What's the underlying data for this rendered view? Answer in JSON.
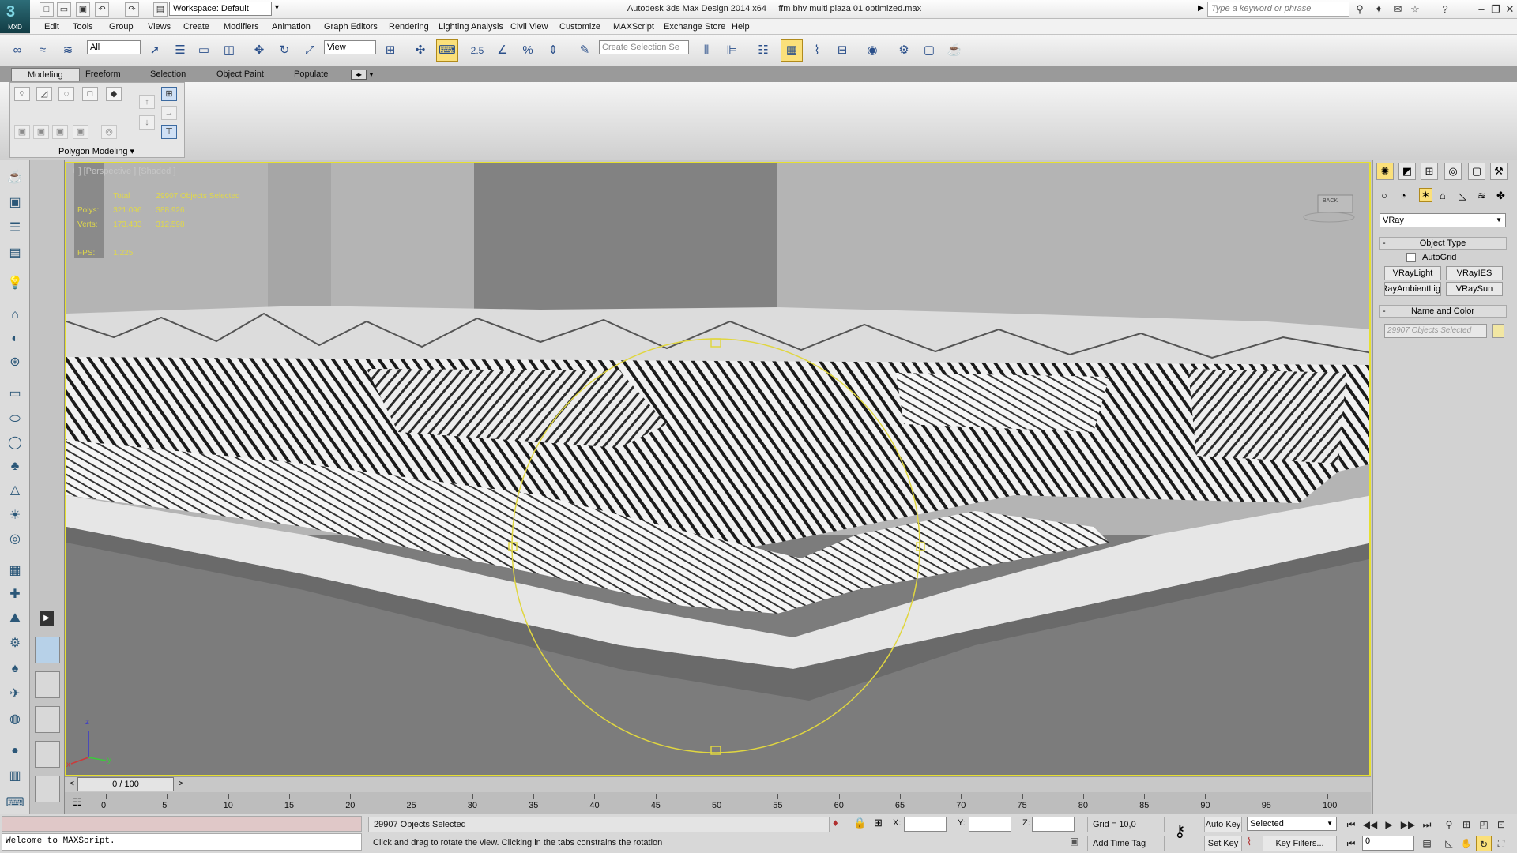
{
  "app": {
    "badge": "MXD",
    "title": "Autodesk 3ds Max Design 2014 x64",
    "file": "ffm bhv multi plaza 01 optimized.max",
    "workspace": "Workspace: Default",
    "search_placeholder": "Type a keyword or phrase"
  },
  "menu": [
    "Edit",
    "Tools",
    "Group",
    "Views",
    "Create",
    "Modifiers",
    "Animation",
    "Graph Editors",
    "Rendering",
    "Lighting Analysis",
    "Civil View",
    "Customize",
    "MAXScript",
    "Exchange Store",
    "Help"
  ],
  "toolbar": {
    "filter": "All",
    "refcoord": "View",
    "snap_label": "2.5",
    "selection_set_placeholder": "Create Selection Se"
  },
  "ribbon": {
    "tabs": [
      "Modeling",
      "Freeform",
      "Selection",
      "Object Paint",
      "Populate"
    ],
    "active_tab": "Modeling",
    "panel_label": "Polygon Modeling"
  },
  "viewport": {
    "label": "+ ] [Perspective ] [Shaded ]",
    "stats": {
      "total_label": "Total",
      "selected_label": "29907 Objects Selected",
      "polys_label": "Polys:",
      "polys_total": "321.096",
      "polys_selected": "388.926",
      "verts_label": "Verts:",
      "verts_total": "173.433",
      "verts_selected": "312.598",
      "fps_label": "FPS:",
      "fps_value": "1,225"
    },
    "viewcube_label": "BACK",
    "axis_z": "z",
    "axis_x": "x",
    "axis_y": "y",
    "accent": "#e6e030"
  },
  "command_panel": {
    "category": "VRay",
    "object_type_title": "Object Type",
    "autogrid": "AutoGrid",
    "buttons": [
      "VRayLight",
      "VRayIES",
      "VRayAmbientLig",
      "VRaySun"
    ],
    "name_color_title": "Name and Color",
    "name_value": "29907 Objects Selected",
    "swatch_color": "#f2e7a3"
  },
  "timeline": {
    "frame": "0 / 100",
    "ticks": [
      "0",
      "5",
      "10",
      "15",
      "20",
      "25",
      "30",
      "35",
      "40",
      "45",
      "50",
      "55",
      "60",
      "65",
      "70",
      "75",
      "80",
      "85",
      "90",
      "95",
      "100"
    ]
  },
  "status": {
    "maxscript": "Welcome to MAXScript.",
    "selection": "29907 Objects Selected",
    "prompt": "Click and drag to rotate the view.  Clicking in the tabs constrains the rotation",
    "x_label": "X:",
    "y_label": "Y:",
    "z_label": "Z:",
    "grid": "Grid = 10,0",
    "add_time_tag": "Add Time Tag",
    "auto_key": "Auto Key",
    "set_key": "Set Key",
    "key_mode": "Selected",
    "key_filters": "Key Filters...",
    "current_frame": "0"
  }
}
